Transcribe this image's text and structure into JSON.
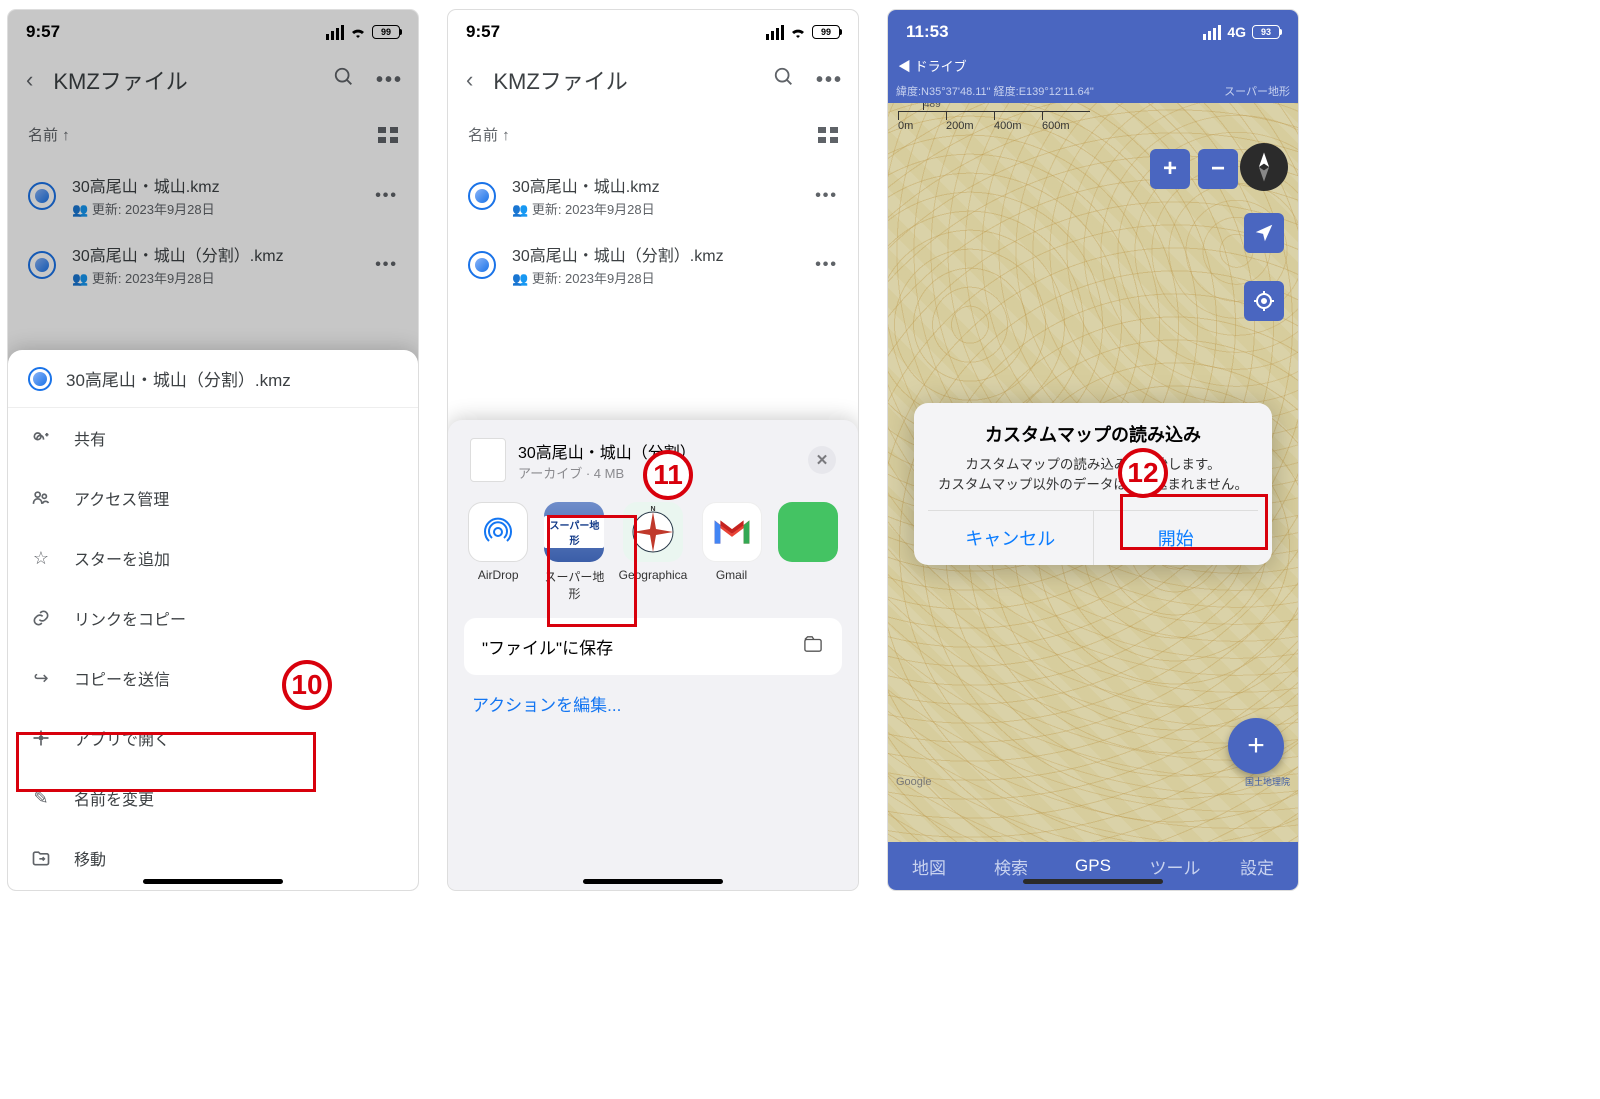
{
  "status": {
    "time": "9:57",
    "battery": "99"
  },
  "drive": {
    "title": "KMZファイル",
    "sort_label": "名前 ↑",
    "files": [
      {
        "name": "30高尾山・城山.kmz",
        "sub": "更新: 2023年9月28日"
      },
      {
        "name": "30高尾山・城山（分割）.kmz",
        "sub": "更新: 2023年9月28日"
      }
    ]
  },
  "context_menu": {
    "file": "30高尾山・城山（分割）.kmz",
    "items": {
      "share": "共有",
      "access": "アクセス管理",
      "star": "スターを追加",
      "copylink": "リンクをコピー",
      "sendcopy": "コピーを送信",
      "openwith": "アプリで開く",
      "rename": "名前を変更",
      "move": "移動"
    }
  },
  "share_sheet": {
    "file": "30高尾山・城山（分割）",
    "sub": "アーカイブ · 4 MB",
    "apps": {
      "airdrop": "AirDrop",
      "super": "スーパー地形",
      "geographica": "Geographica",
      "gmail": "Gmail"
    },
    "save_to_files": "\"ファイル\"に保存",
    "edit_actions": "アクションを編集..."
  },
  "map": {
    "time": "11:53",
    "net": "4G",
    "battery": "93",
    "back": "◀ ドライブ",
    "lat": "緯度:N35°37'48.11\"",
    "lon": "経度:E139°12'11.64\"",
    "layer": "スーパー地形",
    "scale": {
      "ticks": [
        "0m",
        "200m",
        "400m",
        "600m"
      ],
      "minor": "489"
    },
    "tabs": {
      "map": "地図",
      "search": "検索",
      "gps": "GPS",
      "tool": "ツール",
      "settings": "設定"
    },
    "attribution": "Google",
    "credit": "国土地理院"
  },
  "dialog": {
    "title": "カスタムマップの読み込み",
    "msg1": "カスタムマップの読み込みを開始します。",
    "msg2": "カスタムマップ以外のデータは読み込まれません。",
    "cancel": "キャンセル",
    "ok": "開始"
  },
  "steps": {
    "s10": "10",
    "s11": "11",
    "s12": "12"
  }
}
